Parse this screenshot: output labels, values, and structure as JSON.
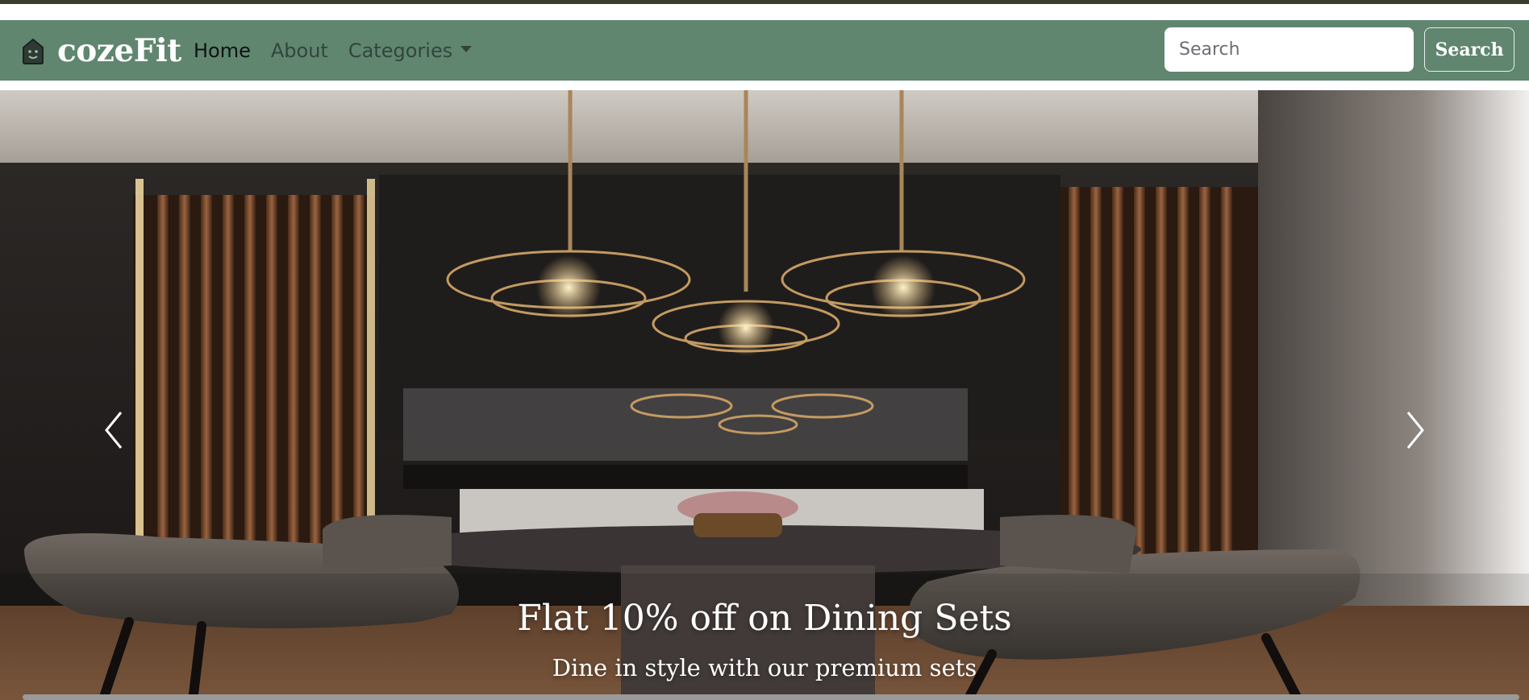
{
  "brand": {
    "name": "cozeFit",
    "logo_icon": "house-face-icon"
  },
  "nav": {
    "items": [
      {
        "label": "Home",
        "active": true
      },
      {
        "label": "About",
        "active": false
      },
      {
        "label": "Categories",
        "active": false,
        "has_dropdown": true
      }
    ]
  },
  "search": {
    "placeholder": "Search",
    "button_label": "Search"
  },
  "carousel": {
    "prev_icon": "chevron-left-icon",
    "next_icon": "chevron-right-icon",
    "slide": {
      "title": "Flat 10% off on Dining Sets",
      "subtitle": "Dine in style with our premium sets"
    }
  },
  "colors": {
    "navbar": "#608670",
    "topbar": "#3a3f2c",
    "brand_text": "#ffffff"
  }
}
